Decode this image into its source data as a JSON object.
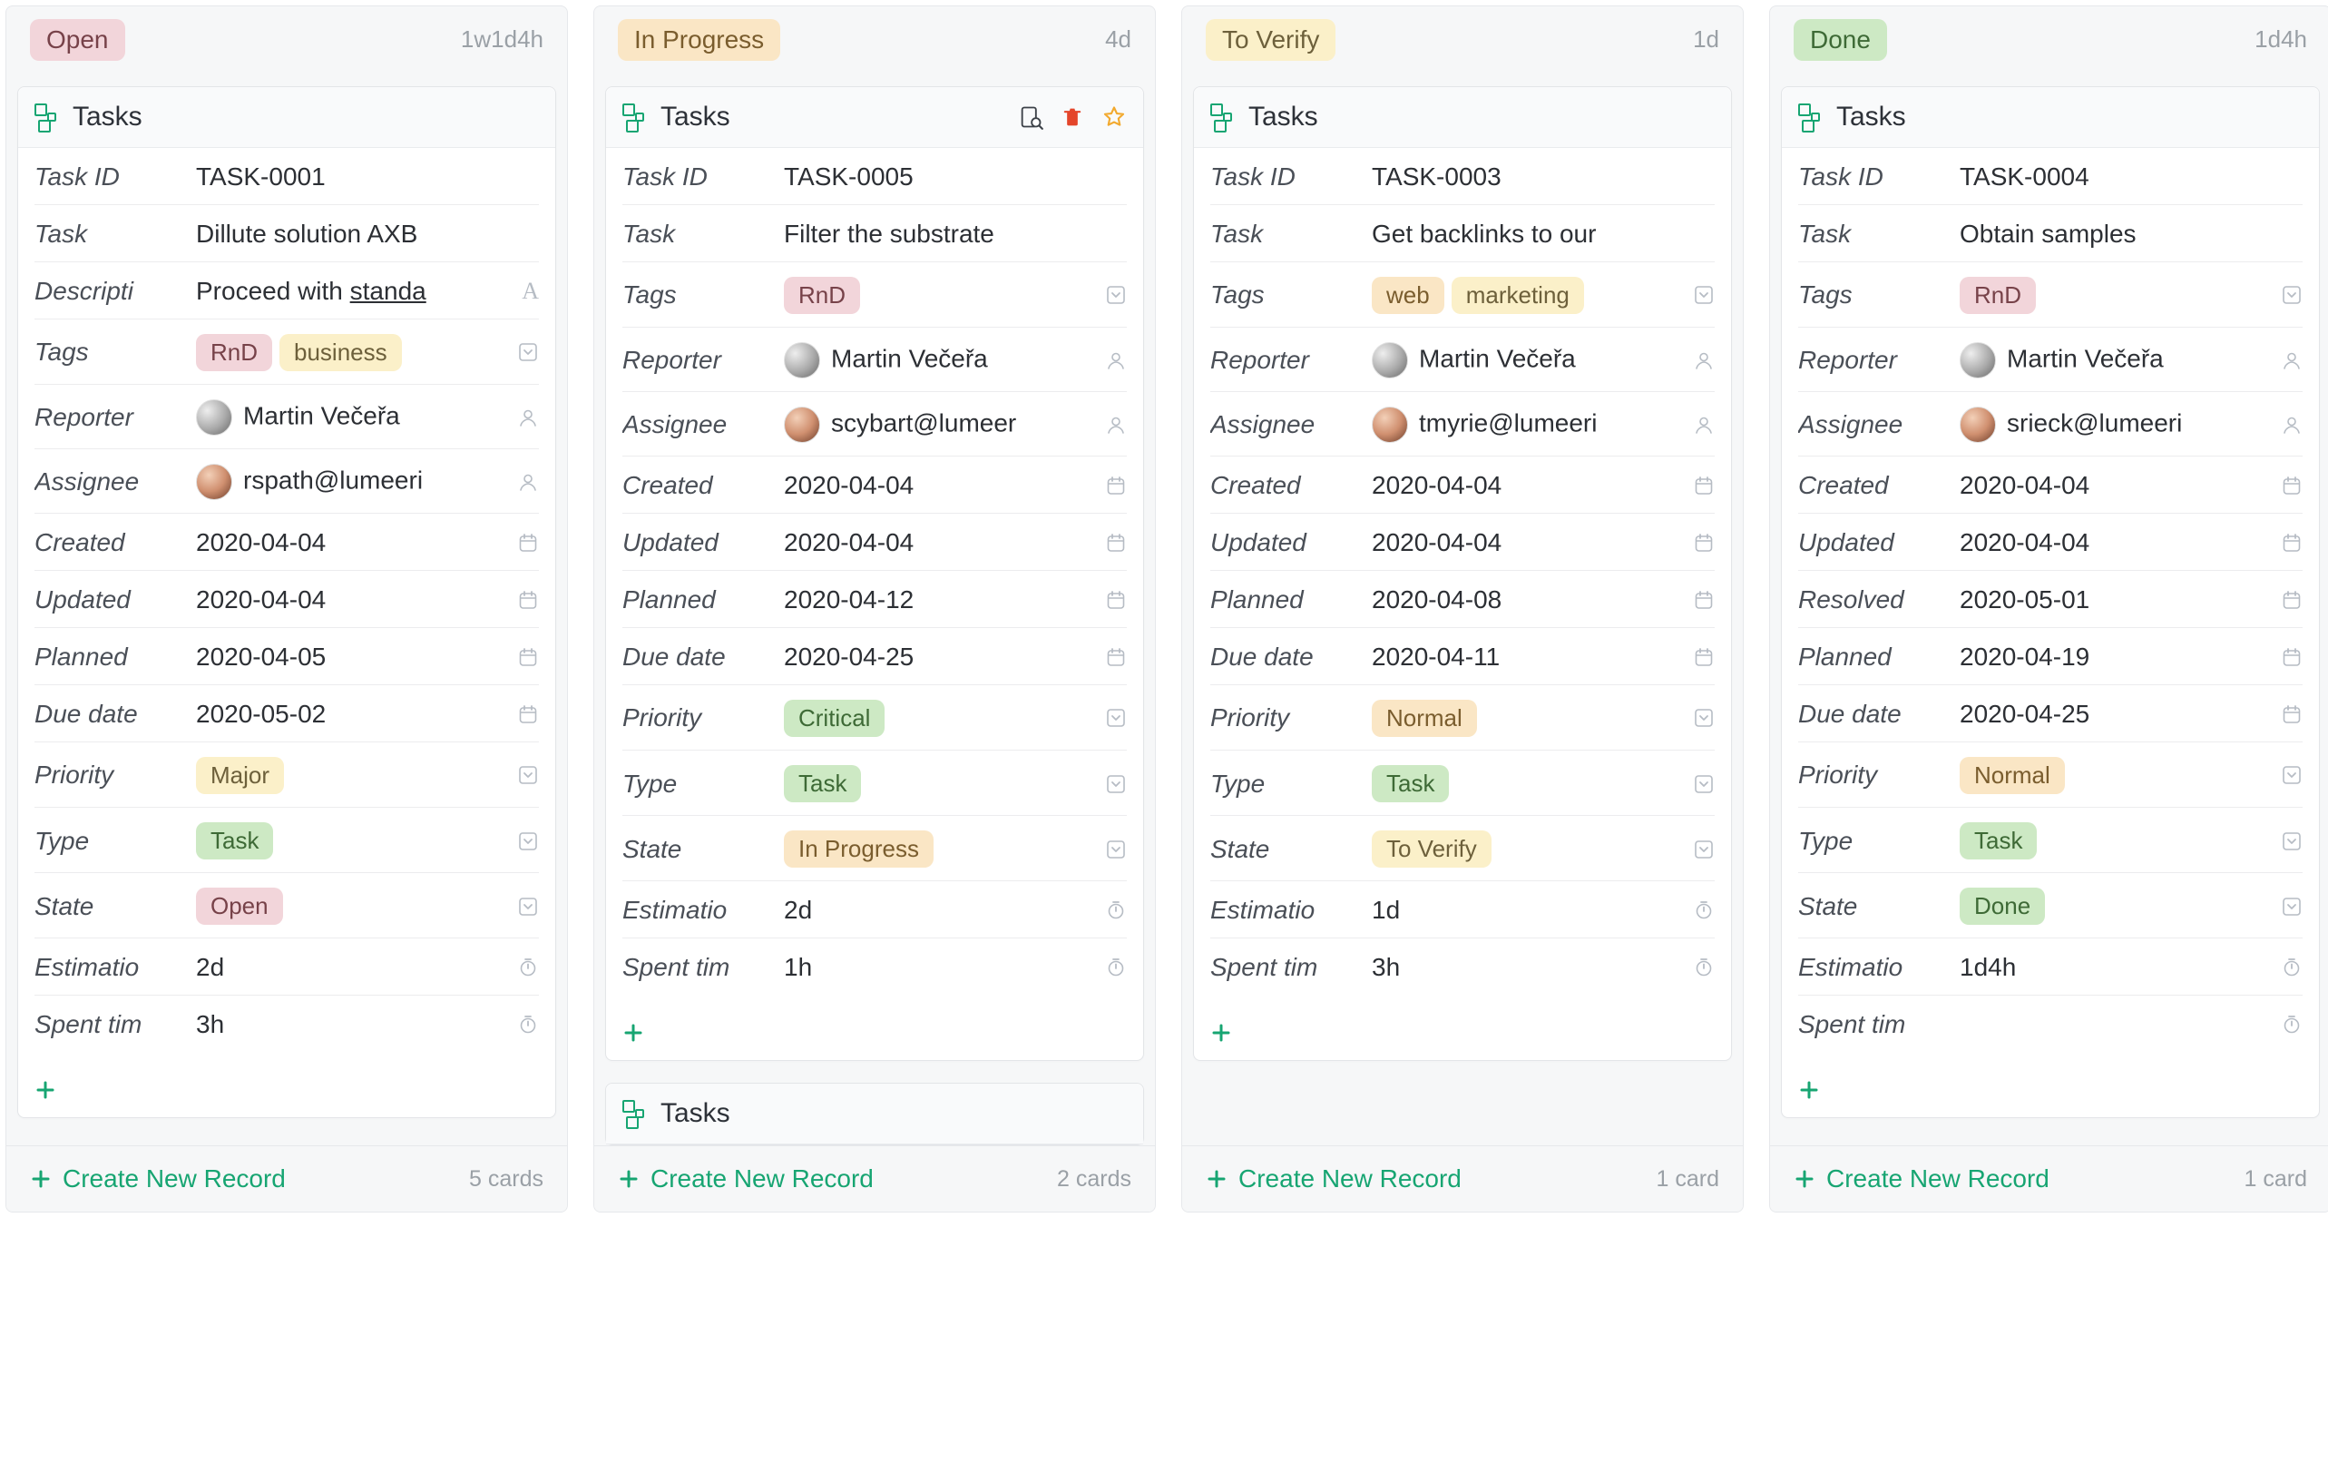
{
  "board": {
    "columns": [
      {
        "id": "open",
        "label": "Open",
        "pillClass": "pill-pink",
        "tally": "1w1d4h",
        "footerCount": "5 cards",
        "createLabel": "Create New Record",
        "card": {
          "header": "Tasks",
          "showActions": false,
          "rows": [
            {
              "label": "Task ID",
              "type": "text",
              "value": "TASK-0001",
              "tail": ""
            },
            {
              "label": "Task",
              "type": "text",
              "value": "Dillute solution AXB",
              "tail": ""
            },
            {
              "label": "Descripti",
              "type": "html",
              "html": "Proceed with <span class=\"underline\">standa</span>",
              "tail": "A"
            },
            {
              "label": "Tags",
              "type": "pills",
              "pills": [
                {
                  "text": "RnD",
                  "cls": "pill-pink"
                },
                {
                  "text": "business",
                  "cls": "pill-yellow"
                }
              ],
              "tail": "chev"
            },
            {
              "label": "Reporter",
              "type": "user",
              "avatar": "m",
              "name": "Martin Večeřa",
              "tail": "user"
            },
            {
              "label": "Assignee",
              "type": "user",
              "avatar": "f",
              "name": "rspath@lumeeri",
              "tail": "user"
            },
            {
              "label": "Created",
              "type": "text",
              "value": "2020-04-04",
              "tail": "cal"
            },
            {
              "label": "Updated",
              "type": "text",
              "value": "2020-04-04",
              "tail": "cal"
            },
            {
              "label": "Planned",
              "type": "text",
              "value": "2020-04-05",
              "tail": "cal"
            },
            {
              "label": "Due date",
              "type": "text",
              "value": "2020-05-02",
              "tail": "cal"
            },
            {
              "label": "Priority",
              "type": "pill",
              "pill": {
                "text": "Major",
                "cls": "pill-yellow"
              },
              "tail": "chev"
            },
            {
              "label": "Type",
              "type": "pill",
              "pill": {
                "text": "Task",
                "cls": "pill-green"
              },
              "tail": "chev"
            },
            {
              "label": "State",
              "type": "pill",
              "pill": {
                "text": "Open",
                "cls": "pill-pink"
              },
              "tail": "chev"
            },
            {
              "label": "Estimatio",
              "type": "text",
              "value": "2d",
              "tail": "timer"
            },
            {
              "label": "Spent tim",
              "type": "text",
              "value": "3h",
              "tail": "timer"
            }
          ]
        },
        "extraCard": null
      },
      {
        "id": "inprogress",
        "label": "In Progress",
        "pillClass": "pill-peach",
        "tally": "4d",
        "footerCount": "2 cards",
        "createLabel": "Create New Record",
        "card": {
          "header": "Tasks",
          "showActions": true,
          "rows": [
            {
              "label": "Task ID",
              "type": "text",
              "value": "TASK-0005",
              "tail": ""
            },
            {
              "label": "Task",
              "type": "text",
              "value": "Filter the substrate",
              "tail": ""
            },
            {
              "label": "Tags",
              "type": "pills",
              "pills": [
                {
                  "text": "RnD",
                  "cls": "pill-pink"
                }
              ],
              "tail": "chev"
            },
            {
              "label": "Reporter",
              "type": "user",
              "avatar": "m",
              "name": "Martin Večeřa",
              "tail": "user"
            },
            {
              "label": "Assignee",
              "type": "user",
              "avatar": "f",
              "name": "scybart@lumeer",
              "tail": "user"
            },
            {
              "label": "Created",
              "type": "text",
              "value": "2020-04-04",
              "tail": "cal"
            },
            {
              "label": "Updated",
              "type": "text",
              "value": "2020-04-04",
              "tail": "cal"
            },
            {
              "label": "Planned",
              "type": "text",
              "value": "2020-04-12",
              "tail": "cal"
            },
            {
              "label": "Due date",
              "type": "text",
              "value": "2020-04-25",
              "tail": "cal"
            },
            {
              "label": "Priority",
              "type": "pill",
              "pill": {
                "text": "Critical",
                "cls": "pill-green"
              },
              "tail": "chev"
            },
            {
              "label": "Type",
              "type": "pill",
              "pill": {
                "text": "Task",
                "cls": "pill-green"
              },
              "tail": "chev"
            },
            {
              "label": "State",
              "type": "pill",
              "pill": {
                "text": "In Progress",
                "cls": "pill-peach"
              },
              "tail": "chev"
            },
            {
              "label": "Estimatio",
              "type": "text",
              "value": "2d",
              "tail": "timer"
            },
            {
              "label": "Spent tim",
              "type": "text",
              "value": "1h",
              "tail": "timer"
            }
          ]
        },
        "extraCard": {
          "header": "Tasks"
        }
      },
      {
        "id": "toverify",
        "label": "To Verify",
        "pillClass": "pill-yellow",
        "tally": "1d",
        "footerCount": "1 card",
        "createLabel": "Create New Record",
        "card": {
          "header": "Tasks",
          "showActions": false,
          "rows": [
            {
              "label": "Task ID",
              "type": "text",
              "value": "TASK-0003",
              "tail": ""
            },
            {
              "label": "Task",
              "type": "text",
              "value": "Get backlinks to our",
              "tail": ""
            },
            {
              "label": "Tags",
              "type": "pills",
              "pills": [
                {
                  "text": "web",
                  "cls": "pill-peach"
                },
                {
                  "text": "marketing",
                  "cls": "pill-yellow"
                }
              ],
              "tail": "chev"
            },
            {
              "label": "Reporter",
              "type": "user",
              "avatar": "m",
              "name": "Martin Večeřa",
              "tail": "user"
            },
            {
              "label": "Assignee",
              "type": "user",
              "avatar": "f",
              "name": "tmyrie@lumeeri",
              "tail": "user"
            },
            {
              "label": "Created",
              "type": "text",
              "value": "2020-04-04",
              "tail": "cal"
            },
            {
              "label": "Updated",
              "type": "text",
              "value": "2020-04-04",
              "tail": "cal"
            },
            {
              "label": "Planned",
              "type": "text",
              "value": "2020-04-08",
              "tail": "cal"
            },
            {
              "label": "Due date",
              "type": "text",
              "value": "2020-04-11",
              "tail": "cal"
            },
            {
              "label": "Priority",
              "type": "pill",
              "pill": {
                "text": "Normal",
                "cls": "pill-peach"
              },
              "tail": "chev"
            },
            {
              "label": "Type",
              "type": "pill",
              "pill": {
                "text": "Task",
                "cls": "pill-green"
              },
              "tail": "chev"
            },
            {
              "label": "State",
              "type": "pill",
              "pill": {
                "text": "To Verify",
                "cls": "pill-yellow"
              },
              "tail": "chev"
            },
            {
              "label": "Estimatio",
              "type": "text",
              "value": "1d",
              "tail": "timer"
            },
            {
              "label": "Spent tim",
              "type": "text",
              "value": "3h",
              "tail": "timer"
            }
          ]
        },
        "extraCard": null
      },
      {
        "id": "done",
        "label": "Done",
        "pillClass": "pill-green",
        "tally": "1d4h",
        "footerCount": "1 card",
        "createLabel": "Create New Record",
        "card": {
          "header": "Tasks",
          "showActions": false,
          "rows": [
            {
              "label": "Task ID",
              "type": "text",
              "value": "TASK-0004",
              "tail": ""
            },
            {
              "label": "Task",
              "type": "text",
              "value": "Obtain samples",
              "tail": ""
            },
            {
              "label": "Tags",
              "type": "pills",
              "pills": [
                {
                  "text": "RnD",
                  "cls": "pill-pink"
                }
              ],
              "tail": "chev"
            },
            {
              "label": "Reporter",
              "type": "user",
              "avatar": "m",
              "name": "Martin Večeřa",
              "tail": "user"
            },
            {
              "label": "Assignee",
              "type": "user",
              "avatar": "f",
              "name": "srieck@lumeeri",
              "tail": "user"
            },
            {
              "label": "Created",
              "type": "text",
              "value": "2020-04-04",
              "tail": "cal"
            },
            {
              "label": "Updated",
              "type": "text",
              "value": "2020-04-04",
              "tail": "cal"
            },
            {
              "label": "Resolved",
              "type": "text",
              "value": "2020-05-01",
              "tail": "cal"
            },
            {
              "label": "Planned",
              "type": "text",
              "value": "2020-04-19",
              "tail": "cal"
            },
            {
              "label": "Due date",
              "type": "text",
              "value": "2020-04-25",
              "tail": "cal"
            },
            {
              "label": "Priority",
              "type": "pill",
              "pill": {
                "text": "Normal",
                "cls": "pill-peach"
              },
              "tail": "chev"
            },
            {
              "label": "Type",
              "type": "pill",
              "pill": {
                "text": "Task",
                "cls": "pill-green"
              },
              "tail": "chev"
            },
            {
              "label": "State",
              "type": "pill",
              "pill": {
                "text": "Done",
                "cls": "pill-green"
              },
              "tail": "chev"
            },
            {
              "label": "Estimatio",
              "type": "text",
              "value": "1d4h",
              "tail": "timer"
            },
            {
              "label": "Spent tim",
              "type": "text",
              "value": "",
              "tail": "timer"
            }
          ]
        },
        "extraCard": null
      }
    ]
  }
}
